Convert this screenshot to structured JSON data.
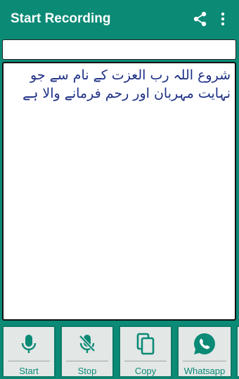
{
  "app_bar": {
    "title": "Start Recording",
    "share_icon": "share-icon",
    "more_icon": "more-vert-icon"
  },
  "top_input": {
    "value": "",
    "placeholder": ""
  },
  "text_area": {
    "value": "شروع اللہ رب العزت کے نام سے جو نہایت مہربان اور رحم فرمانے والا ہے"
  },
  "actions": [
    {
      "label": "Start",
      "icon": "mic-icon"
    },
    {
      "label": "Stop",
      "icon": "mic-off-icon"
    },
    {
      "label": "Copy",
      "icon": "copy-icon"
    },
    {
      "label": "Whatsapp",
      "icon": "whatsapp-icon"
    }
  ],
  "colors": {
    "primary": "#0b8a76",
    "text_urdu": "#1d2f86",
    "button_bg": "#e3e7e6"
  }
}
